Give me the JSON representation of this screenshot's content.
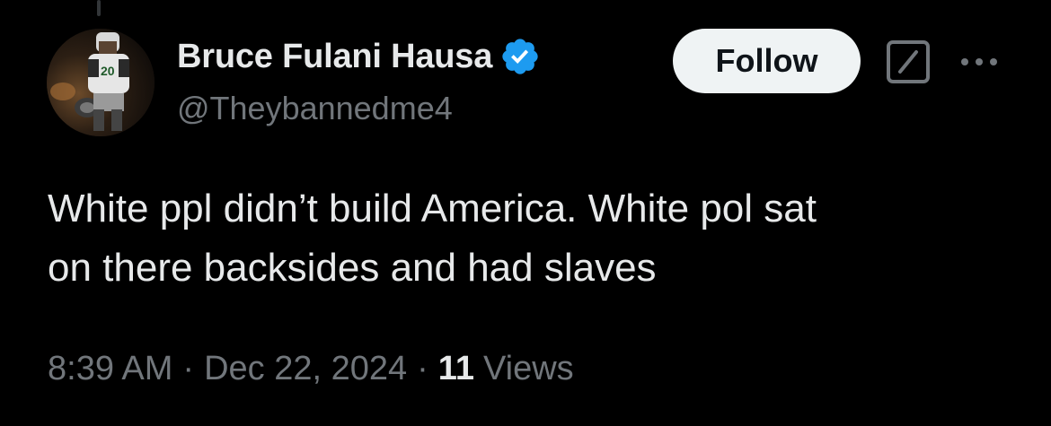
{
  "author": {
    "display_name": "Bruce Fulani Hausa",
    "handle": "@Theybannedme4",
    "verified": true,
    "avatar_icon": "profile-photo"
  },
  "actions": {
    "follow_label": "Follow",
    "grok_icon": "grok-icon",
    "more_icon": "more-dots-icon"
  },
  "tweet": {
    "text": "White ppl didn’t build America. White pol sat\non there backsides and had slaves"
  },
  "meta": {
    "time": "8:39 AM",
    "separator": "·",
    "date": "Dec 22, 2024",
    "views_count": "11",
    "views_label": "Views"
  },
  "colors": {
    "background": "#000000",
    "text_primary": "#e7e9ea",
    "text_secondary": "#71767b",
    "verified_blue": "#1d9bf0",
    "follow_bg": "#eff3f4",
    "follow_text": "#0f1419"
  }
}
